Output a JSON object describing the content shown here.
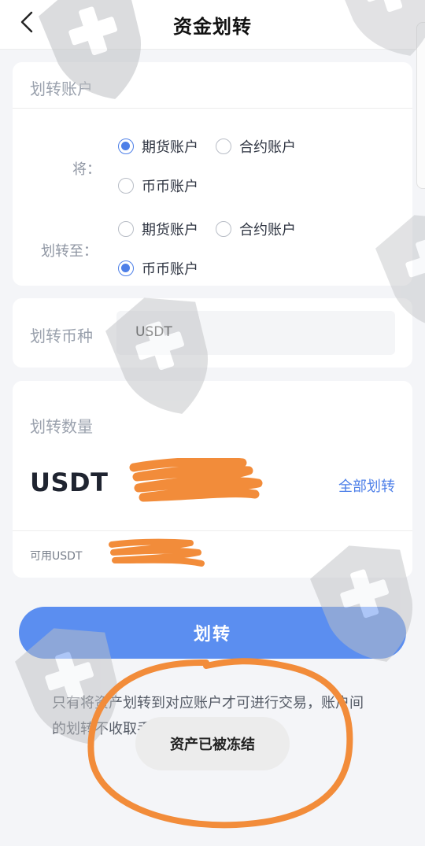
{
  "header": {
    "title": "资金划转",
    "back_icon": "chevron-left-icon"
  },
  "accounts_card": {
    "title": "划转账户",
    "from": {
      "label": "将：",
      "options": [
        {
          "label": "期货账户",
          "checked": true
        },
        {
          "label": "合约账户",
          "checked": false
        },
        {
          "label": "币币账户",
          "checked": false
        }
      ]
    },
    "to": {
      "label": "划转至：",
      "options": [
        {
          "label": "期货账户",
          "checked": false
        },
        {
          "label": "合约账户",
          "checked": false
        },
        {
          "label": "币币账户",
          "checked": true
        }
      ]
    }
  },
  "coin_card": {
    "label": "划转币种",
    "value": "USDT"
  },
  "amount_card": {
    "title": "划转数量",
    "currency": "USDT",
    "all_transfer": "全部划转",
    "available_label": "可用USDT"
  },
  "actions": {
    "transfer_button": "划转"
  },
  "notice": "只有将资产划转到对应账户才可进行交易，账户间的划转不收取手续费",
  "toast": "资产已被冻结",
  "colors": {
    "accent": "#5b8ef0",
    "radio_checked": "#4d7fe8",
    "redaction": "#f28c3a",
    "watermark": "#c7c9cc"
  }
}
